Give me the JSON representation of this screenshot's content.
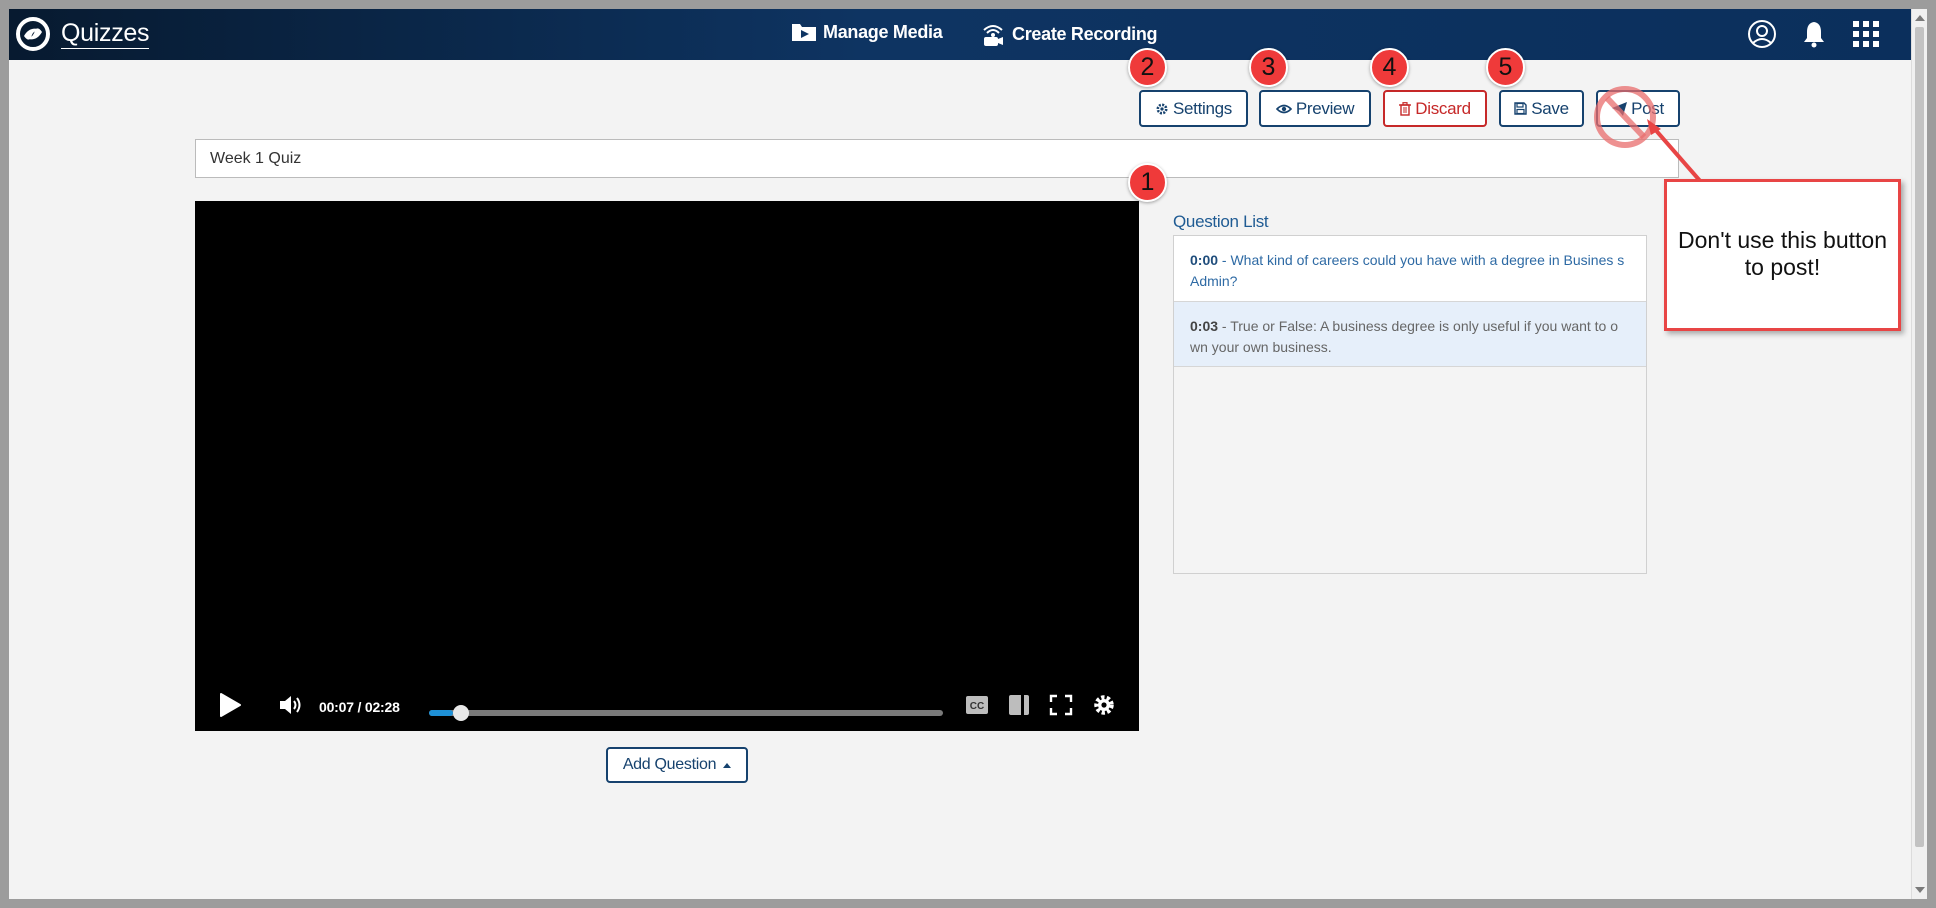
{
  "app": {
    "name": "Quizzes"
  },
  "nav": {
    "manage_media": "Manage Media",
    "create_recording": "Create Recording"
  },
  "toolbar": {
    "settings": "Settings",
    "preview": "Preview",
    "discard": "Discard",
    "save": "Save",
    "post": "Post"
  },
  "steps": [
    "1",
    "2",
    "3",
    "4",
    "5"
  ],
  "title_input": {
    "value": "Week 1 Quiz"
  },
  "player": {
    "time": "00:07 / 02:28",
    "progress": 0.047
  },
  "add_question": "Add Question",
  "question_list": {
    "heading": "Question List",
    "items": [
      {
        "time": "0:00",
        "text": " - What kind of careers could you have with a degree in Busines s Admin?"
      },
      {
        "time": "0:03",
        "text": " - True or False: A business degree is only useful if you want to o wn your own business."
      }
    ]
  },
  "annotation": {
    "text": "Don't use this button to post!"
  },
  "colors": {
    "navbar": "#0e3462",
    "primary": "#16426e",
    "danger": "#c62828",
    "callout": "#ef3a3a",
    "seek": "#1e90d6"
  }
}
